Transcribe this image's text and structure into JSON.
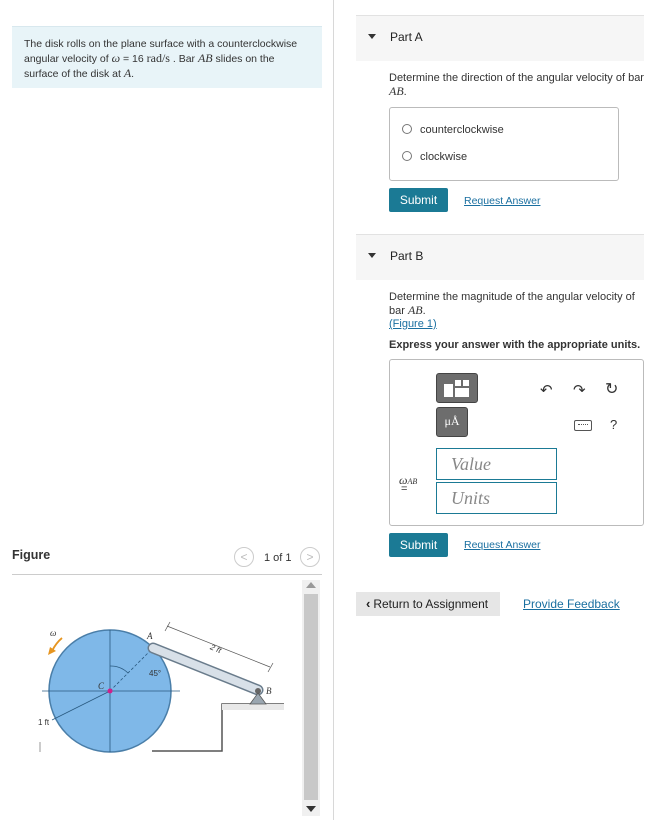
{
  "problem": {
    "line1": "The disk rolls on the plane surface with a counterclockwise",
    "line2_pre": "angular velocity of ",
    "omega": "ω",
    "line2_eq": " = 16 ",
    "unit": "rad/s",
    "line2_mid": " . Bar ",
    "bar": "AB",
    "line2_post": " slides on the",
    "line3_pre": "surface of the disk at ",
    "pointA": "A",
    "line3_post": "."
  },
  "figure": {
    "title": "Figure",
    "counter": "1 of 1",
    "prev_icon": "chevron-left",
    "next_icon": "chevron-right",
    "labels": {
      "omega": "ω",
      "A": "A",
      "C": "C",
      "B": "B",
      "angle": "45°",
      "bar_length": "2 ft",
      "radius": "1 ft"
    }
  },
  "partA": {
    "title": "Part A",
    "question_pre": "Determine the direction of the angular velocity of bar",
    "bar": "AB",
    "question_post": ".",
    "choices": [
      "counterclockwise",
      "clockwise"
    ],
    "submit": "Submit",
    "request": "Request Answer"
  },
  "partB": {
    "title": "Part B",
    "question_pre": "Determine the magnitude of the angular velocity of bar ",
    "bar": "AB",
    "question_post": ".",
    "figure_link": "(Figure 1)",
    "express": "Express your answer with the appropriate units.",
    "variable": "ω",
    "variable_sub": "AB",
    "equals": "=",
    "value_placeholder": "Value",
    "units_placeholder": "Units",
    "mu_label": "μÅ",
    "submit": "Submit",
    "request": "Request Answer"
  },
  "footer": {
    "return": "Return to Assignment",
    "feedback": "Provide Feedback"
  },
  "colors": {
    "accent": "#1b7a95",
    "link": "#1a6fa0",
    "problem_bg": "#e8f4f8",
    "disk": "#7fb8e8"
  }
}
